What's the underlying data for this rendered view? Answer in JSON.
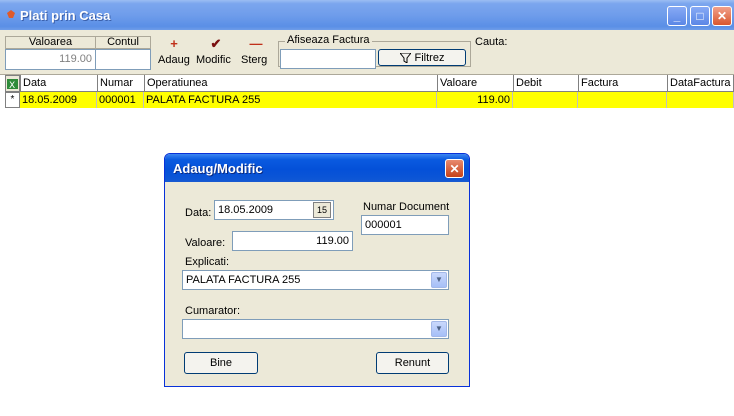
{
  "window": {
    "title": "Plati prin Casa"
  },
  "toolbar": {
    "valoarea_header": "Valoarea",
    "contul_header": "Contul",
    "valoarea_value": "119.00",
    "contul_value": "",
    "adaug_label": "Adaug",
    "modific_label": "Modific",
    "sterg_label": "Sterg",
    "afiseaza_legend": "Afiseaza Factura",
    "filtrez_label": "Filtrez",
    "cauta_label": "Cauta:"
  },
  "grid": {
    "columns": [
      "Data",
      "Numar",
      "Operatiunea",
      "Valoare",
      "Debit",
      "Factura",
      "DataFactura"
    ],
    "rows": [
      {
        "indicator": "*",
        "data": "18.05.2009",
        "numar": "000001",
        "operatiunea": "PALATA FACTURA 255",
        "valoare": "119.00",
        "debit": "",
        "factura": "",
        "datafactura": ""
      }
    ]
  },
  "dialog": {
    "title": "Adaug/Modific",
    "data_label": "Data:",
    "data_value": "18.05.2009",
    "numar_doc_label": "Numar Document",
    "numar_doc_value": "000001",
    "valoare_label": "Valoare:",
    "valoare_value": "119.00",
    "explicati_label": "Explicati:",
    "explicati_value": "PALATA FACTURA 255",
    "cumparator_label": "Cumarator:",
    "cumparator_value": "",
    "bine_label": "Bine",
    "renunt_label": "Renunt"
  },
  "colors": {
    "selected_row": "#ffff00",
    "title_blue": "#0450d8"
  }
}
